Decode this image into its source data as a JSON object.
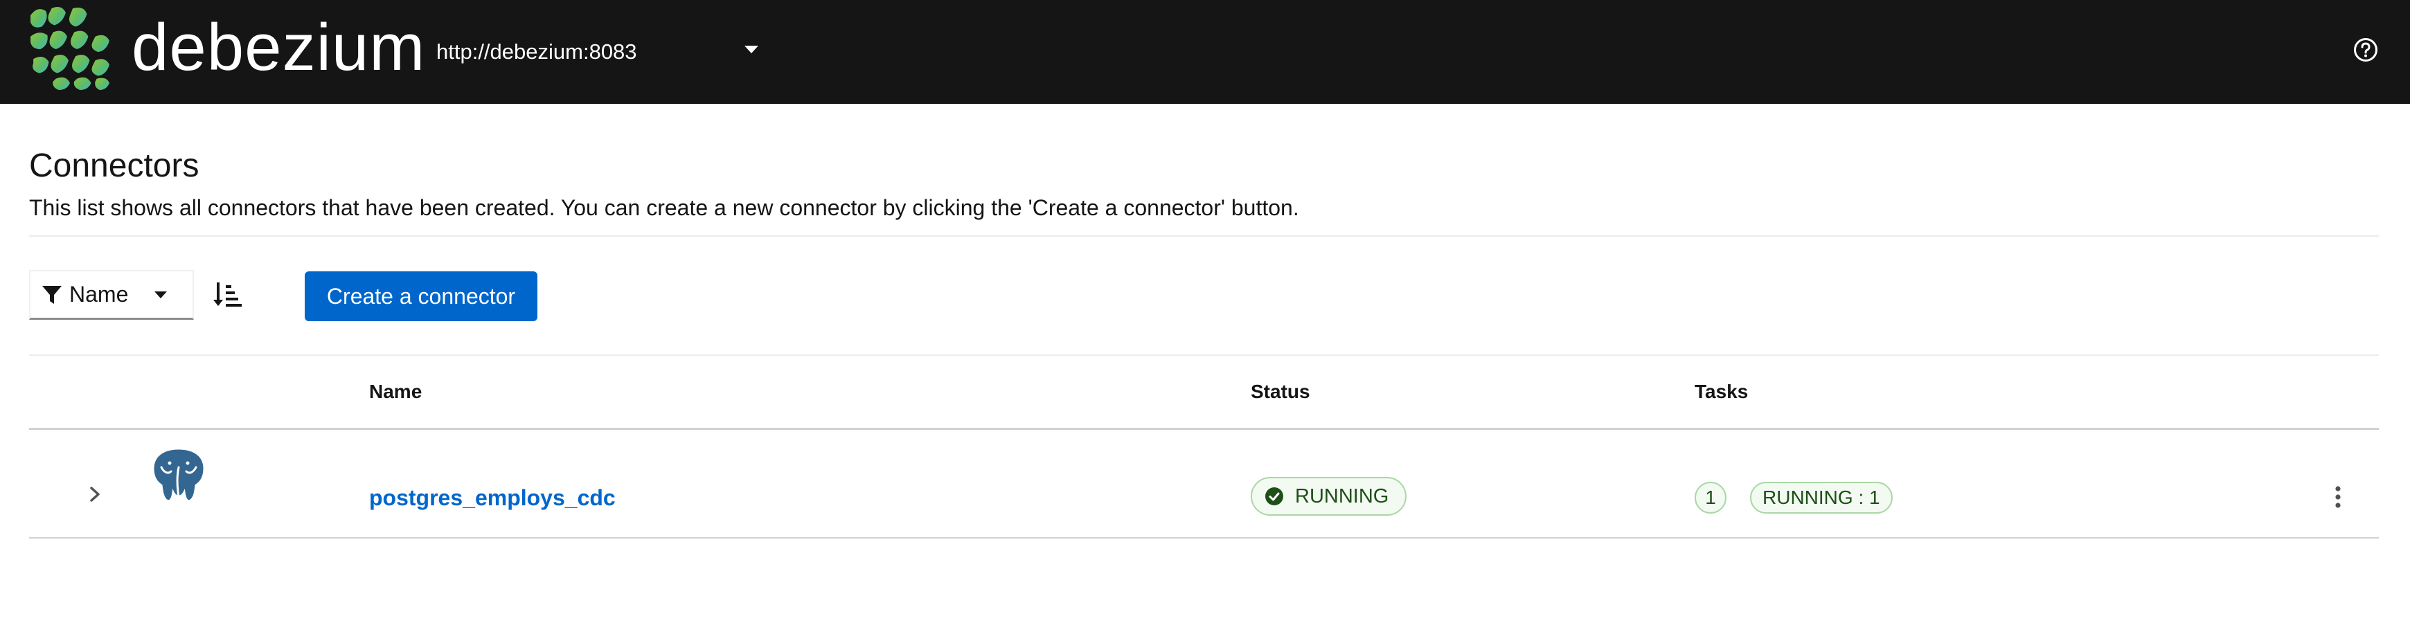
{
  "header": {
    "brand": "debezium",
    "cluster_url": "http://debezium:8083",
    "colors": {
      "background": "#151515",
      "logo_green": "#6fbf4a",
      "logo_teal": "#3fb8c8"
    }
  },
  "page": {
    "title": "Connectors",
    "description": "This list shows all connectors that have been created. You can create a new connector by clicking the 'Create a connector' button."
  },
  "toolbar": {
    "filter_label": "Name",
    "create_label": "Create a connector",
    "primary_color": "#0066cc"
  },
  "table": {
    "columns": {
      "name": "Name",
      "status": "Status",
      "tasks": "Tasks"
    },
    "rows": [
      {
        "name": "postgres_employs_cdc",
        "icon": "postgres-elephant-icon",
        "status": "RUNNING",
        "task_count": "1",
        "task_status": "RUNNING : 1"
      }
    ]
  }
}
